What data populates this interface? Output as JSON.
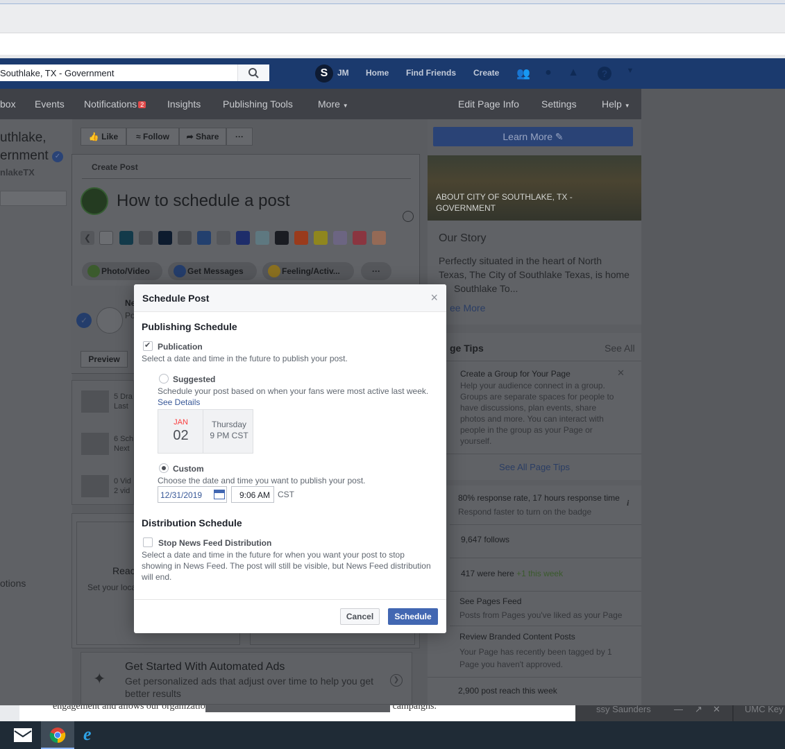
{
  "browser": {},
  "fb_header": {
    "search_value": "Southlake, TX - Government",
    "user_initials": "JM",
    "nav": [
      "Home",
      "Find Friends",
      "Create"
    ]
  },
  "page_nav": {
    "items": [
      "box",
      "Events",
      "Notifications",
      "Insights",
      "Publishing Tools",
      "More"
    ],
    "notifications_badge": "2",
    "right_items": [
      "Edit Page Info",
      "Settings",
      "Help"
    ]
  },
  "left": {
    "name_line1": "uthlake,",
    "name_line2": "ernment",
    "handle": "nlakeTX",
    "options_fragment": "otions"
  },
  "actions": {
    "like": "Like",
    "follow": "Follow",
    "share": "Share",
    "more": "···"
  },
  "create_post": {
    "title": "Create Post",
    "post_text": "How to schedule a post",
    "pills": [
      "Photo/Video",
      "Get Messages",
      "Feeling/Activ..."
    ],
    "more": "···",
    "preview": "Preview",
    "fragments": {
      "ne": "Ne",
      "po": "Po"
    }
  },
  "side_list": [
    {
      "line1": "5 Dra",
      "line2": "Last"
    },
    {
      "line1": "6 Sch",
      "line2": "Next"
    },
    {
      "line1": "0 Vid",
      "line2": "2 vid"
    }
  ],
  "lower": {
    "heading_fragment": "Reac",
    "sub_fragment": "Set your loca"
  },
  "ads": {
    "title": "Get Started With Automated Ads",
    "subtitle": "Get personalized ads that adjust over time to help you get better results"
  },
  "right": {
    "learn_more": "Learn More",
    "about": "ABOUT CITY OF SOUTHLAKE, TX - GOVERNMENT",
    "story_title": "Our Story",
    "story_text_1": "Perfectly situated in the heart of North",
    "story_text_2": "Texas, The City of Southlake Texas, is home",
    "story_text_3": "Southlake To...",
    "see_more": "ee More",
    "tips_title": "ge Tips",
    "see_all": "See All",
    "tip_title": "Create a Group for Your Page",
    "tip_text": "Help your audience connect in a group. Groups are separate spaces for people to have discussions, plan events, share photos and more. You can interact with people in the group as your Page or yourself.",
    "see_all_tips": "See All Page Tips",
    "stats": [
      {
        "title": "80% response rate, 17 hours response time",
        "sub": "Respond faster to turn on the badge"
      },
      {
        "title": "9,647 follows",
        "sub": ""
      },
      {
        "title": "417 were here",
        "sub": "+1 this week"
      },
      {
        "title": "See Pages Feed",
        "sub": "Posts from Pages you've liked as your Page"
      },
      {
        "title": "Review Branded Content Posts",
        "sub": "Your Page has recently been tagged by 1 Page you haven't approved."
      },
      {
        "title": "2,900 post reach this week",
        "sub": ""
      }
    ]
  },
  "bottom": {
    "doc_text": "engagement and allows our organization to be able to participate in popular or national campaigns.",
    "right_name": "ssy Saunders",
    "right_name2": "UMC Key"
  },
  "modal": {
    "title": "Schedule Post",
    "close": "×",
    "publishing_schedule": "Publishing Schedule",
    "publication_label": "Publication",
    "publication_checked": true,
    "publication_desc": "Select a date and time in the future to publish your post.",
    "suggested_label": "Suggested",
    "suggested_desc": "Schedule your post based on when your fans were most active last week.",
    "see_details": "See Details",
    "suggested_month": "JAN",
    "suggested_day": "02",
    "suggested_weekday": "Thursday",
    "suggested_time": "9 PM CST",
    "custom_label": "Custom",
    "custom_selected": true,
    "custom_desc": "Choose the date and time you want to publish your post.",
    "date_value": "12/31/2019",
    "time_value": "9:06 AM",
    "timezone": "CST",
    "distribution_schedule": "Distribution Schedule",
    "stop_label": "Stop News Feed Distribution",
    "stop_checked": false,
    "stop_desc": "Select a date and time in the future for when you want your post to stop showing in News Feed. The post will still be visible, but News Feed distribution will end.",
    "cancel": "Cancel",
    "schedule": "Schedule"
  },
  "colors": {
    "fb_blue": "#4267b2",
    "header": "#1b3a6e",
    "link": "#385898"
  }
}
